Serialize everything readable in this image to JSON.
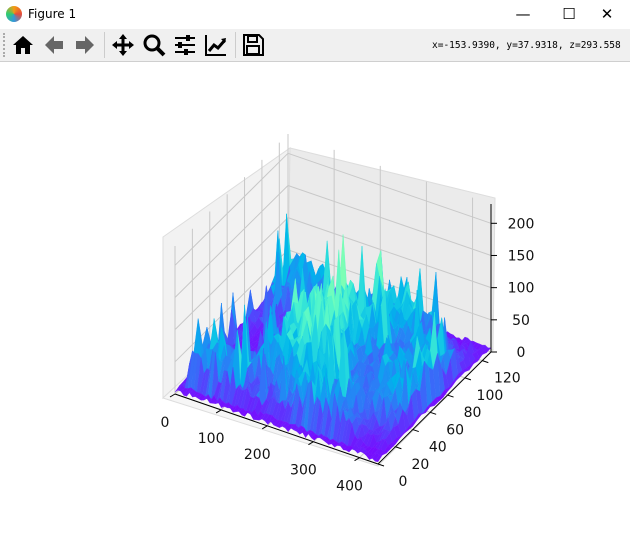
{
  "window": {
    "title": "Figure 1",
    "minimize": "—",
    "maximize": "☐",
    "close": "✕"
  },
  "toolbar": {
    "buttons": [
      "home",
      "back",
      "forward",
      "pan",
      "zoom",
      "configure-subplots",
      "edit-axis",
      "save"
    ],
    "coords": "x=-153.9390, y=37.9318, z=293.558"
  },
  "chart_data": {
    "type": "surface",
    "colormap": "rainbow",
    "title": "",
    "xlabel": "",
    "ylabel": "",
    "zlabel": "",
    "xlim": [
      0,
      440
    ],
    "ylim": [
      0,
      130
    ],
    "zlim": [
      0,
      230
    ],
    "x_ticks": [
      "0",
      "100",
      "200",
      "300",
      "400"
    ],
    "y_ticks": [
      "0",
      "20",
      "40",
      "60",
      "80",
      "100",
      "120"
    ],
    "z_ticks": [
      "0",
      "50",
      "100",
      "150",
      "200"
    ],
    "grid": true
  }
}
